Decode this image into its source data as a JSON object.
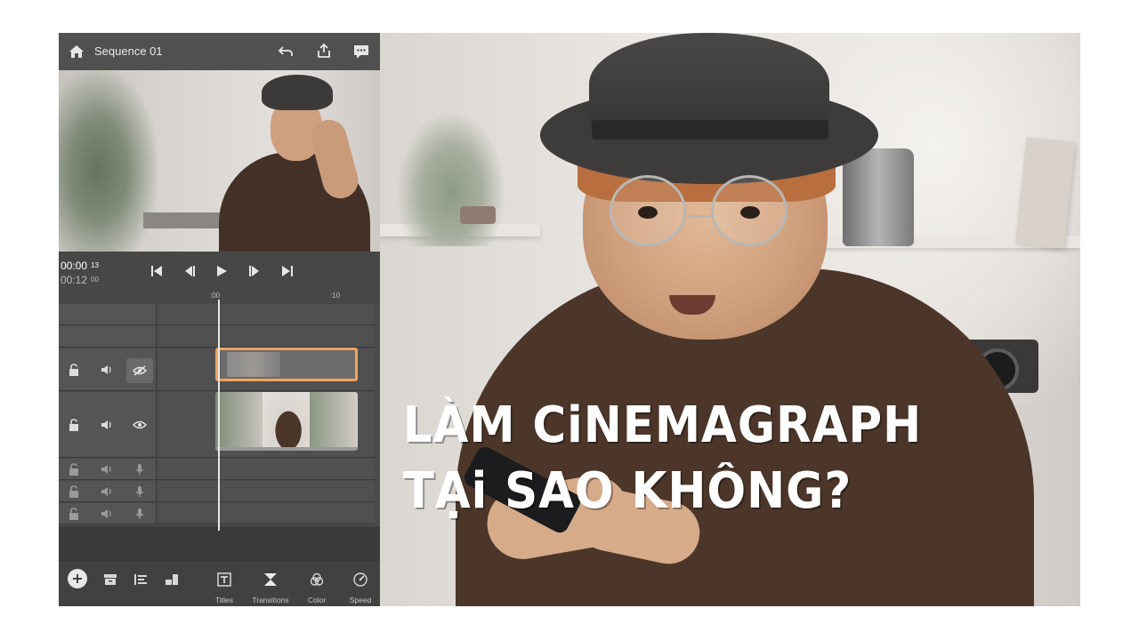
{
  "editor": {
    "sequence_title": "Sequence 01",
    "timecode_current": "00:00",
    "timecode_current_frames": "13",
    "timecode_total": "00:12",
    "timecode_total_frames": "00",
    "ruler_labels": [
      ":00",
      ":10"
    ],
    "toolbar": {
      "titles_label": "Titles",
      "transitions_label": "Transitions",
      "color_label": "Color",
      "speed_label": "Speed"
    },
    "accent_color": "#f3a35c"
  },
  "overlay": {
    "line1": "LÀM CiNEMAGRAPH",
    "line2": "TẠi SAO KHÔNG?"
  }
}
